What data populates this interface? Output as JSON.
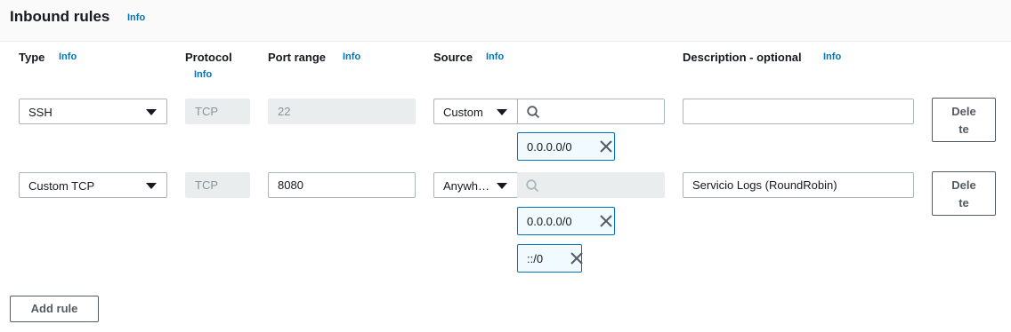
{
  "header": {
    "title": "Inbound rules",
    "info": "Info"
  },
  "columns": {
    "type": "Type",
    "type_info": "Info",
    "protocol": "Protocol",
    "protocol_info": "Info",
    "port_range": "Port range",
    "port_info": "Info",
    "source": "Source",
    "source_info": "Info",
    "description": "Description - optional",
    "description_info": "Info"
  },
  "rules": [
    {
      "type": "SSH",
      "protocol": "TCP",
      "port": "22",
      "source": "Custom",
      "tokens": [
        "0.0.0.0/0"
      ],
      "description": "",
      "delete_l1": "Dele",
      "delete_l2": "te"
    },
    {
      "type": "Custom TCP",
      "protocol": "TCP",
      "port": "8080",
      "source": "Anywh…",
      "tokens": [
        "0.0.0.0/0",
        "::/0"
      ],
      "description": "Servicio Logs (RoundRobin)",
      "delete_l1": "Dele",
      "delete_l2": "te"
    }
  ],
  "add_rule": "Add rule",
  "colors": {
    "link": "#0073bb",
    "token_border": "#0073bb",
    "token_bg": "#f1faff",
    "disabled_bg": "#eaeded"
  },
  "icons": [
    "search-icon",
    "close-icon",
    "caret-down-icon"
  ]
}
